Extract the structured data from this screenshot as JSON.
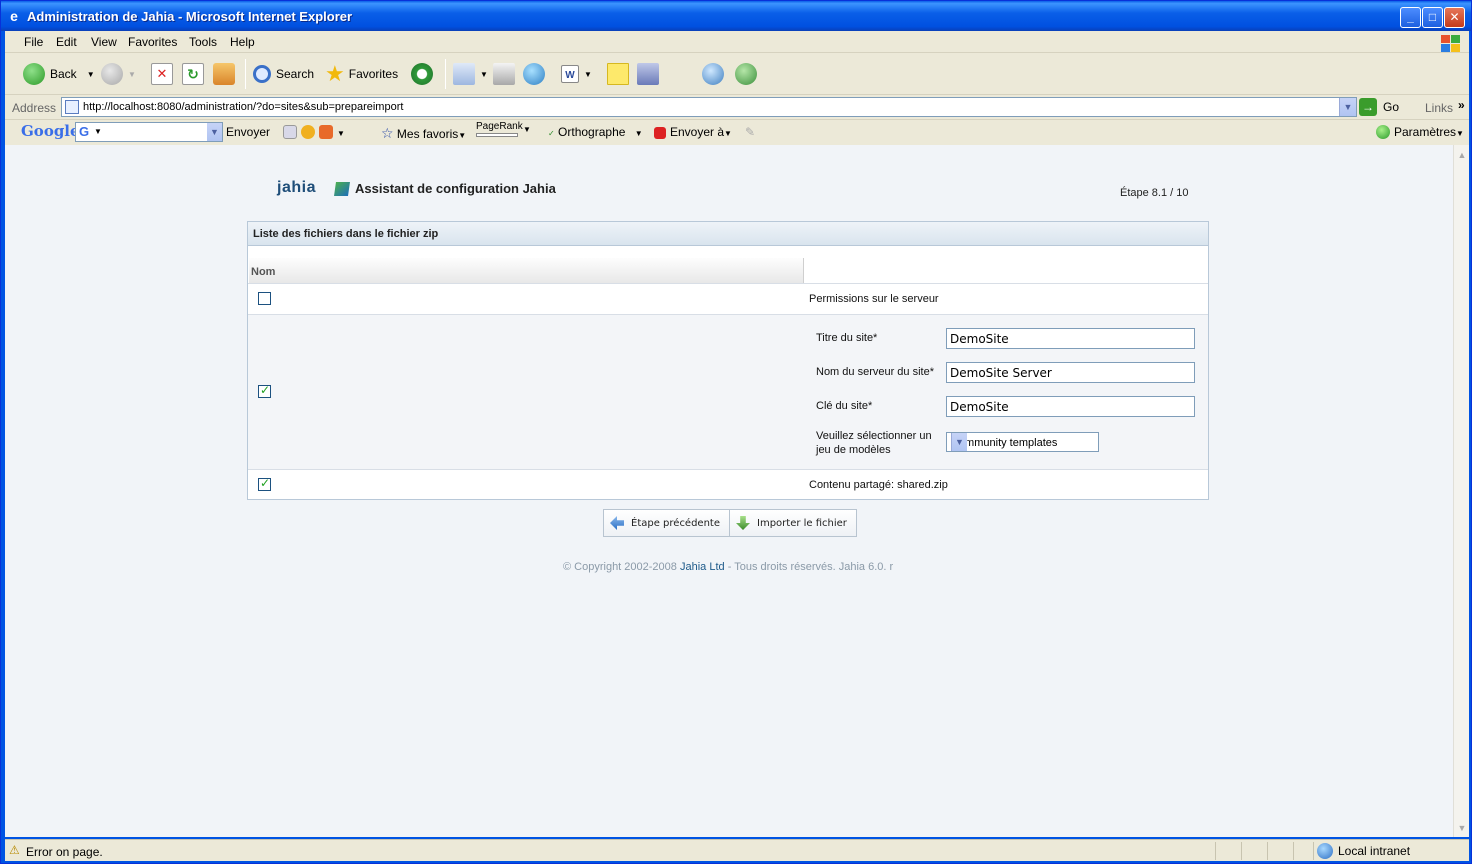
{
  "window": {
    "title": "Administration de Jahia - Microsoft Internet Explorer"
  },
  "menu": {
    "items": [
      "File",
      "Edit",
      "View",
      "Favorites",
      "Tools",
      "Help"
    ]
  },
  "toolbar": {
    "back_label": "Back",
    "search_label": "Search",
    "favorites_label": "Favorites"
  },
  "address": {
    "label": "Address",
    "url": "http://localhost:8080/administration/?do=sites&sub=prepareimport",
    "go_label": "Go",
    "links_label": "Links"
  },
  "google_toolbar": {
    "logo_text": "Google",
    "search_letter": "G",
    "send_label": "Envoyer",
    "favorites_label": "Mes favoris",
    "pagerank_label": "PageRank",
    "spellcheck_label": "Orthographe",
    "send_to_label": "Envoyer à",
    "settings_label": "Paramètres"
  },
  "page": {
    "logo_text": "jahia",
    "wizard_title": "Assistant de configuration Jahia",
    "step": "Étape 8.1 / 10",
    "panel_title": "Liste des fichiers dans le fichier zip",
    "column_name": "Nom",
    "rows": [
      {
        "label": "Permissions sur le serveur",
        "checked": false
      },
      {
        "checked": true
      },
      {
        "label": "Contenu partagé: shared.zip",
        "checked": true
      }
    ],
    "site_form": {
      "title_label": "Titre du site*",
      "title_value": "DemoSite",
      "server_label": "Nom du serveur du site*",
      "server_value": "DemoSite Server",
      "key_label": "Clé du site*",
      "key_value": "DemoSite",
      "template_label_line1": "Veuillez sélectionner un",
      "template_label_line2": "jeu de modèles",
      "template_selected": "Community templates"
    },
    "buttons": {
      "previous": "Étape précédente",
      "import": "Importer le fichier"
    },
    "footer": {
      "prefix": "© Copyright 2002-2008",
      "company": "Jahia Ltd",
      "suffix": "- Tous droits réservés. Jahia 6.0. r"
    }
  },
  "status": {
    "message": "Error on page.",
    "zone": "Local intranet"
  },
  "colors": {
    "titlebar": "#0054e3",
    "chrome": "#ece9d8",
    "content_bg": "#f1f4f8",
    "link": "#1d5a8a"
  }
}
